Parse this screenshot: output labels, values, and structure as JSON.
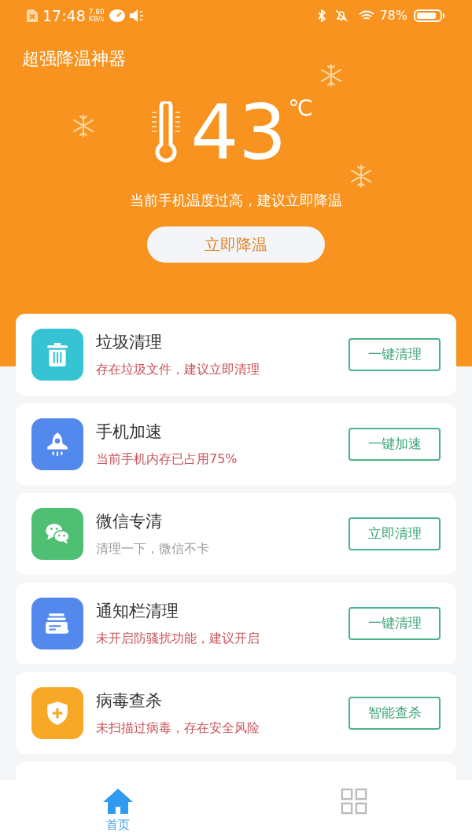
{
  "status_bar": {
    "time": "17:48",
    "speed_value": "7.80",
    "speed_unit": "KB/s",
    "battery": "78%"
  },
  "app_title": "超强降温神器",
  "temperature": {
    "value": "43",
    "unit": "℃",
    "message": "当前手机温度过高，建议立即降温",
    "button": "立即降温"
  },
  "tools": [
    {
      "color": "#36c4d4",
      "title": "垃圾清理",
      "subtitle": "存在垃圾文件，建议立即清理",
      "kind": "warning",
      "button": "一键清理"
    },
    {
      "color": "#5388ec",
      "title": "手机加速",
      "subtitle": "当前手机内存已占用75%",
      "kind": "warning",
      "button": "一键加速"
    },
    {
      "color": "#4fbf74",
      "title": "微信专清",
      "subtitle": "清理一下，微信不卡",
      "kind": "normal",
      "button": "立即清理"
    },
    {
      "color": "#5388ec",
      "title": "通知栏清理",
      "subtitle": "未开启防骚扰功能，建议开启",
      "kind": "warning",
      "button": "一键清理"
    },
    {
      "color": "#f7a826",
      "title": "病毒查杀",
      "subtitle": "未扫描过病毒，存在安全风险",
      "kind": "warning",
      "button": "智能查杀"
    }
  ],
  "bottom_nav": [
    {
      "label": "首页",
      "selected": true
    },
    {
      "selected": false
    }
  ]
}
